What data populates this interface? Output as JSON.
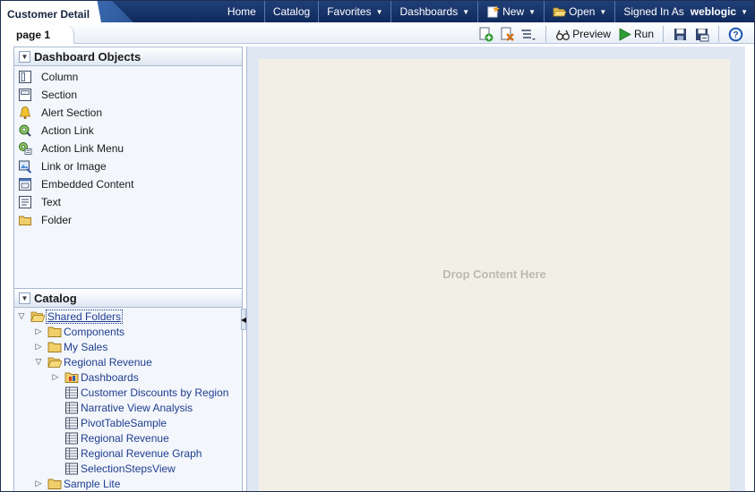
{
  "header": {
    "title": "Customer Detail",
    "nav": [
      {
        "label": "Home",
        "icon": "",
        "caret": false
      },
      {
        "label": "Catalog",
        "icon": "",
        "caret": false
      },
      {
        "label": "Favorites",
        "icon": "",
        "caret": true
      },
      {
        "label": "Dashboards",
        "icon": "",
        "caret": true
      },
      {
        "label": "New",
        "icon": "new-icon",
        "caret": true
      },
      {
        "label": "Open",
        "icon": "folder-open-icon",
        "caret": true
      }
    ],
    "signed_in_label": "Signed In As",
    "user": "weblogic"
  },
  "page_tab": {
    "label": "page 1"
  },
  "toolbar": {
    "add_page_icon": "add-page-icon",
    "delete_page_icon": "delete-page-icon",
    "page_options_icon": "page-options-icon",
    "preview_label": "Preview",
    "run_label": "Run",
    "save_icon": "save-icon",
    "save_as_icon": "save-as-icon",
    "help_icon": "help-icon"
  },
  "objects_panel": {
    "title": "Dashboard Objects",
    "items": [
      {
        "label": "Column",
        "icon": "column-icon"
      },
      {
        "label": "Section",
        "icon": "section-icon"
      },
      {
        "label": "Alert Section",
        "icon": "bell-icon"
      },
      {
        "label": "Action Link",
        "icon": "action-link-icon"
      },
      {
        "label": "Action Link Menu",
        "icon": "action-link-menu-icon"
      },
      {
        "label": "Link or Image",
        "icon": "link-image-icon"
      },
      {
        "label": "Embedded Content",
        "icon": "embedded-content-icon"
      },
      {
        "label": "Text",
        "icon": "text-icon"
      },
      {
        "label": "Folder",
        "icon": "folder-icon"
      }
    ]
  },
  "catalog_panel": {
    "title": "Catalog",
    "tree": [
      {
        "label": "Shared Folders",
        "level": 0,
        "type": "folder-open",
        "expanded": true,
        "selected": true
      },
      {
        "label": "Components",
        "level": 1,
        "type": "folder",
        "expanded": false
      },
      {
        "label": "My Sales",
        "level": 1,
        "type": "folder",
        "expanded": false
      },
      {
        "label": "Regional Revenue",
        "level": 1,
        "type": "folder",
        "expanded": true
      },
      {
        "label": "Dashboards",
        "level": 2,
        "type": "dashboard-folder",
        "expanded": false
      },
      {
        "label": "Customer Discounts by Region",
        "level": 2,
        "type": "analysis"
      },
      {
        "label": "Narrative View Analysis",
        "level": 2,
        "type": "analysis"
      },
      {
        "label": "PivotTableSample",
        "level": 2,
        "type": "analysis"
      },
      {
        "label": "Regional Revenue",
        "level": 2,
        "type": "analysis"
      },
      {
        "label": "Regional Revenue Graph",
        "level": 2,
        "type": "analysis"
      },
      {
        "label": "SelectionStepsView",
        "level": 2,
        "type": "analysis"
      },
      {
        "label": "Sample Lite",
        "level": 1,
        "type": "folder",
        "expanded": false
      }
    ]
  },
  "canvas": {
    "drop_text": "Drop Content Here"
  },
  "colors": {
    "header": "#0f2a5c",
    "canvas": "#f2f0e6",
    "link": "#1e3d8f"
  }
}
